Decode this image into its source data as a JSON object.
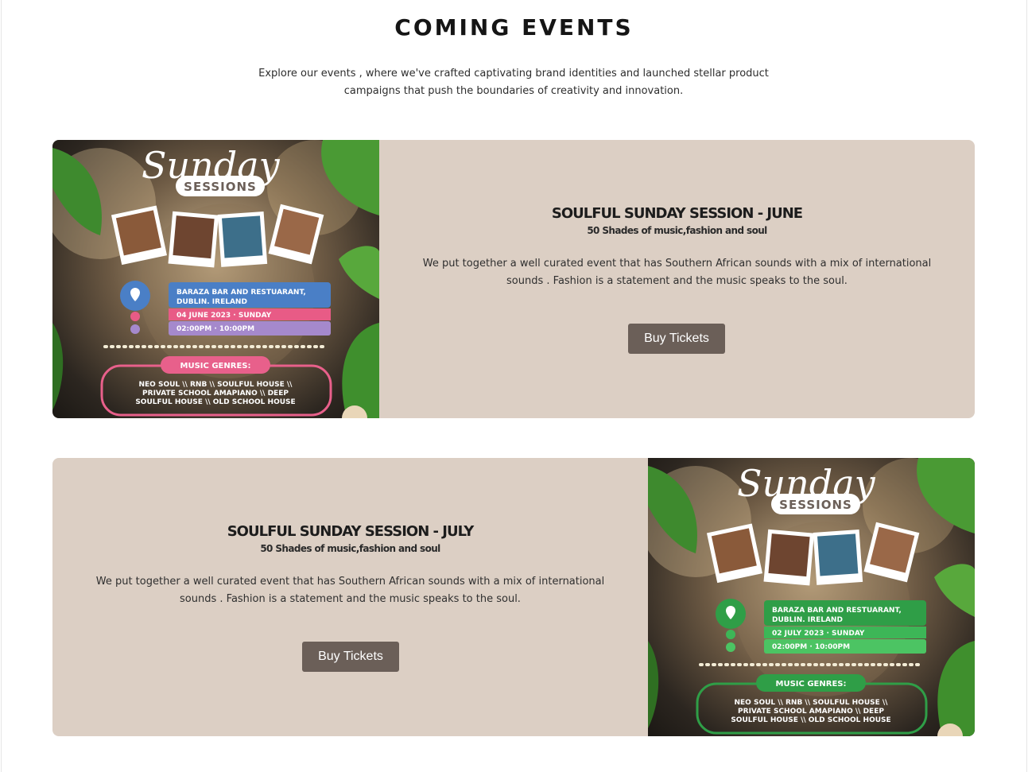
{
  "section": {
    "title": "COMING EVENTS",
    "intro": "Explore our events , where we've crafted captivating brand identities and launched stellar product campaigns that push the boundaries of creativity and innovation."
  },
  "events": [
    {
      "title": "SOULFUL SUNDAY SESSION - JUNE",
      "subtitle": "50 Shades of music,fashion and soul",
      "description": "We put together a well curated event that has Southern African sounds with a mix of international sounds . Fashion is a statement and the music speaks to the soul.",
      "button_label": "Buy Tickets",
      "poster": {
        "script_title": "Sunday",
        "sessions_label": "SESSIONS",
        "venue": "BARAZA BAR AND RESTUARANT, DUBLIN. IRELAND",
        "date": "04 JUNE 2023 · SUNDAY",
        "time": "02:00PM · 10:00PM",
        "genres_label": "MUSIC GENRES:",
        "genres": "NEO SOUL \\\\ RNB \\\\ SOULFUL HOUSE \\\\ PRIVATE SCHOOL AMAPIANO \\\\ DEEP SOULFUL HOUSE \\\\ OLD SCHOOL HOUSE",
        "accent": "#4a7fc6",
        "date_color": "#e85b86",
        "time_color": "#a589cc",
        "genre_color": "#e8608b"
      }
    },
    {
      "title": "SOULFUL SUNDAY SESSION - JULY",
      "subtitle": "50 Shades of music,fashion and soul",
      "description": "We put together a well curated event that has Southern African sounds with a mix of international sounds . Fashion is a statement and the music speaks to the soul.",
      "button_label": "Buy Tickets",
      "poster": {
        "script_title": "Sunday",
        "sessions_label": "SESSIONS",
        "venue": "BARAZA BAR AND RESTUARANT, DUBLIN. IRELAND",
        "date": "02 JULY 2023 · SUNDAY",
        "time": "02:00PM · 10:00PM",
        "genres_label": "MUSIC GENRES:",
        "genres": "NEO SOUL \\\\ RNB \\\\ SOULFUL HOUSE \\\\ PRIVATE SCHOOL AMAPIANO \\\\ DEEP SOULFUL HOUSE \\\\ OLD SCHOOL HOUSE",
        "accent": "#2f9e47",
        "date_color": "#3db657",
        "time_color": "#4cc463",
        "genre_color": "#2f9e47"
      }
    }
  ],
  "colors": {
    "card_bg": "#dccfc4",
    "button_bg": "#6b5f58",
    "button_text": "#ffffff"
  }
}
